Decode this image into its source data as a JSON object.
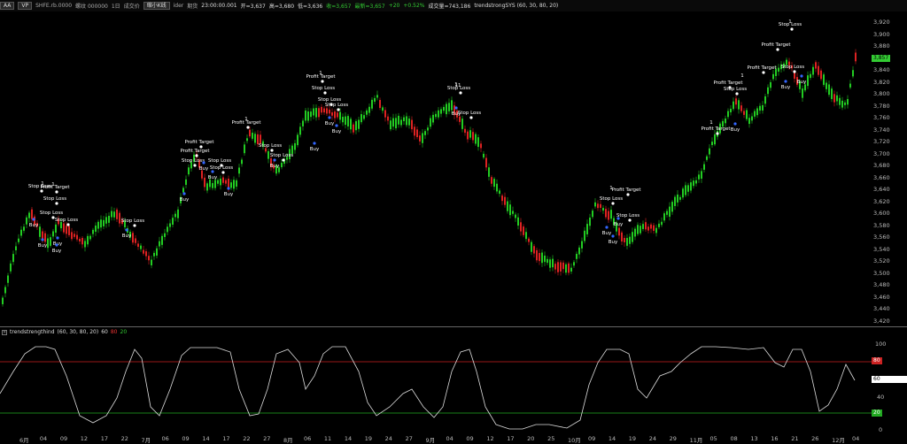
{
  "topbar": {
    "menu_btn": "AA",
    "tag": "VP",
    "symbol": "SHFE.rb.0000",
    "contract": "螺纹 000000",
    "period": "1日",
    "text1": "成交价",
    "chart_btn": "缩小K线",
    "text2": "ider",
    "text3": "期货",
    "time": "23:00:00.001",
    "open": "开=3,637",
    "high": "高=3,680",
    "low": "低=3,636",
    "close": "收=3,657",
    "last": "最新=3,657",
    "chg": "+20",
    "pct": "+0.52%",
    "vol": "成交量=743,186",
    "strategy": "trendstrongSYS (60, 30, 80, 20)"
  },
  "price_axis": [
    "3,920",
    "3,900",
    "3,880",
    "3,860",
    "3,840",
    "3,820",
    "3,800",
    "3,780",
    "3,760",
    "3,740",
    "3,720",
    "3,700",
    "3,680",
    "3,660",
    "3,640",
    "3,620",
    "3,600",
    "3,580",
    "3,560",
    "3,540",
    "3,520",
    "3,500",
    "3,480",
    "3,460",
    "3,440",
    "3,420"
  ],
  "price_badge": "3,857",
  "indicator": {
    "name": "trendstrengthind",
    "params": "(60, 30, 80, 20)",
    "v1": "60",
    "v2": "80",
    "v3": "20",
    "axis": [
      "100",
      "40",
      "0"
    ],
    "badge_80": "80",
    "badge_60": "60",
    "badge_20": "20"
  },
  "dates": [
    "6月",
    "04",
    "09",
    "12",
    "17",
    "22",
    "7月",
    "06",
    "09",
    "14",
    "17",
    "22",
    "27",
    "8月",
    "06",
    "11",
    "14",
    "19",
    "24",
    "27",
    "9月",
    "04",
    "09",
    "12",
    "17",
    "20",
    "25",
    "10月",
    "09",
    "14",
    "19",
    "24",
    "29",
    "11月",
    "05",
    "08",
    "13",
    "16",
    "21",
    "26",
    "12月",
    "04"
  ],
  "signals": {
    "stop_loss": "Stop Loss",
    "profit_target": "Profit Target",
    "buy": "Buy",
    "one": "1",
    "eleven": "11"
  },
  "colors": {
    "up": "#22cc22",
    "down": "#dd2222",
    "line_red": "#cc2222",
    "line_green": "#22aa22",
    "osc": "#dddddd"
  }
}
